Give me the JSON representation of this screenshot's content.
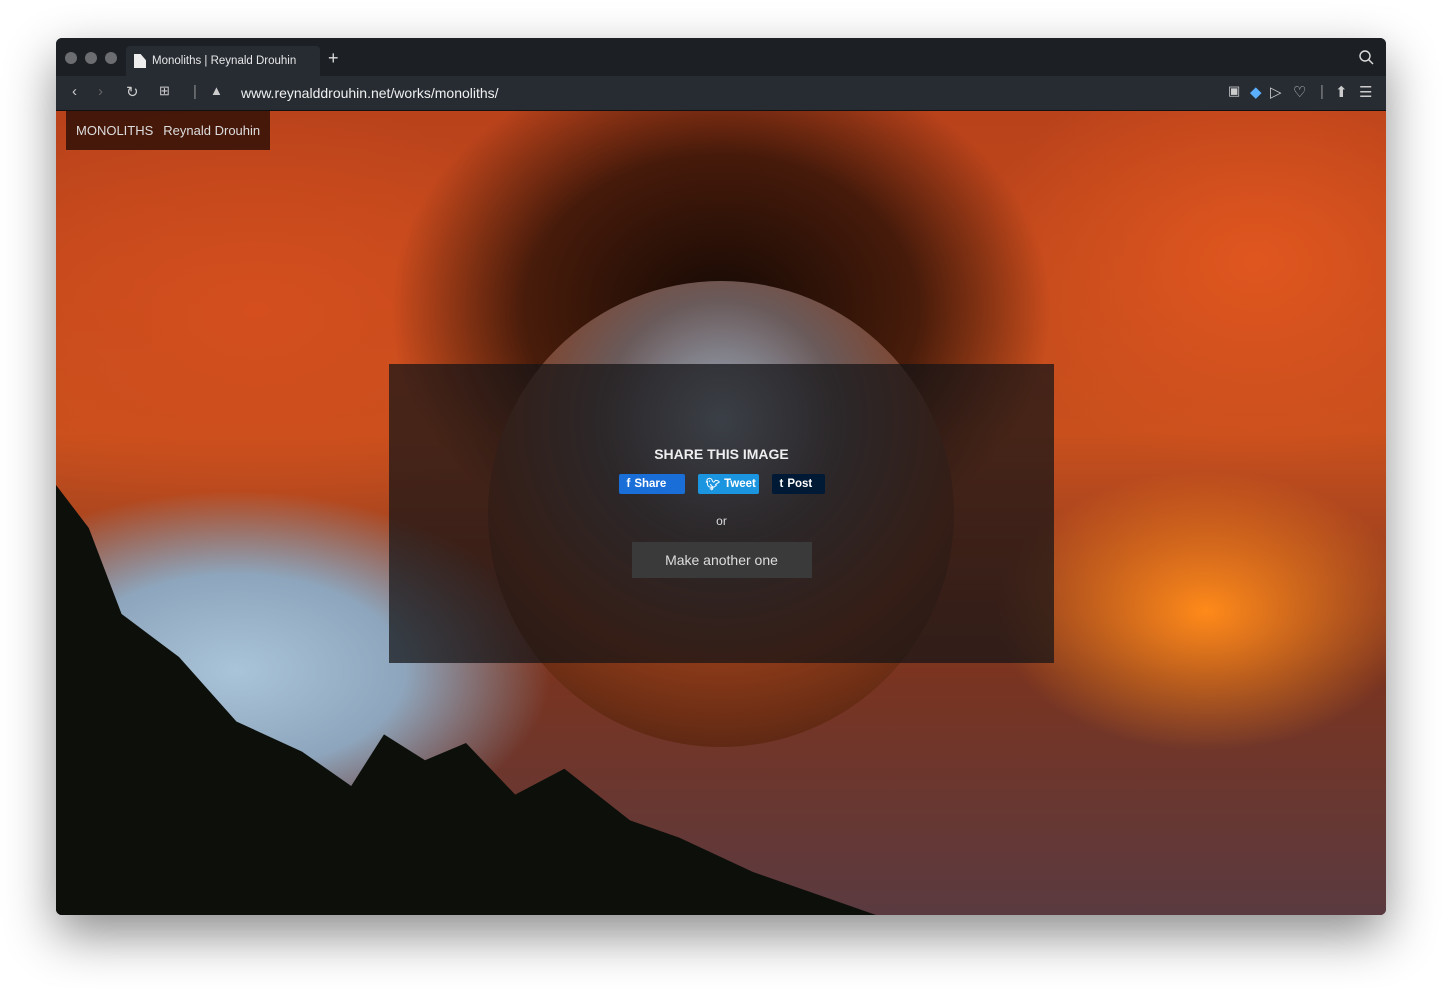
{
  "browser": {
    "tab_title": "Monoliths | Reynald Drouhin",
    "url": "www.reynalddrouhin.net/works/monoliths/"
  },
  "site": {
    "name": "MONOLITHS",
    "author": "Reynald Drouhin"
  },
  "panel": {
    "title": "SHARE THIS IMAGE",
    "share_facebook": "Share",
    "share_twitter": "Tweet",
    "share_tumblr": "Post",
    "or": "or",
    "make_another": "Make another one"
  },
  "colors": {
    "facebook": "#1a6ed8",
    "twitter": "#1b95e0",
    "tumblr": "#001935"
  }
}
